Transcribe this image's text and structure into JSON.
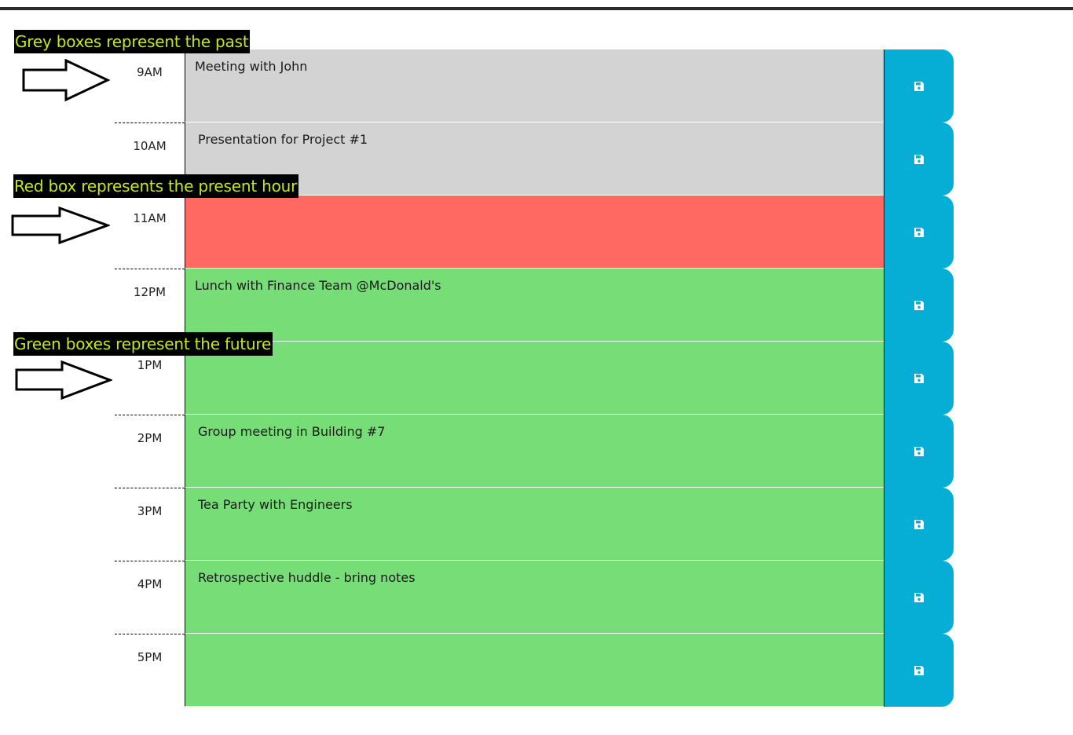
{
  "annotations": {
    "past": "Grey boxes represent the past",
    "present": "Red box represents the present hour",
    "future": "Green boxes represent the future"
  },
  "colors": {
    "past": "#d3d3d3",
    "present": "#ff6961",
    "future": "#77dd77",
    "save_button": "#06aed5",
    "annotation_text": "#c6e619",
    "annotation_bg": "#000000"
  },
  "schedule": [
    {
      "hour": "9AM",
      "state": "past",
      "event": "Meeting with John"
    },
    {
      "hour": "10AM",
      "state": "past",
      "event": "Presentation for Project #1"
    },
    {
      "hour": "11AM",
      "state": "present",
      "event": ""
    },
    {
      "hour": "12PM",
      "state": "future",
      "event": "Lunch with Finance Team @McDonald's"
    },
    {
      "hour": "1PM",
      "state": "future",
      "event": ""
    },
    {
      "hour": "2PM",
      "state": "future",
      "event": "Group meeting in Building #7"
    },
    {
      "hour": "3PM",
      "state": "future",
      "event": "Tea Party with Engineers"
    },
    {
      "hour": "4PM",
      "state": "future",
      "event": "Retrospective huddle - bring notes"
    },
    {
      "hour": "5PM",
      "state": "future",
      "event": ""
    }
  ],
  "icons": {
    "save": "save-icon",
    "arrow": "arrow-right-icon"
  }
}
